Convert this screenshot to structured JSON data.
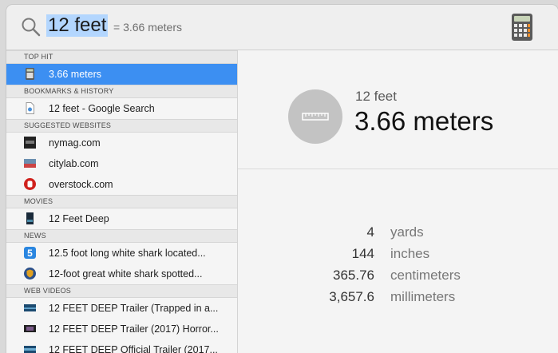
{
  "search": {
    "query": "12 feet",
    "inline_result": "= 3.66 meters"
  },
  "sections": {
    "top_hit": "TOP HIT",
    "bookmarks": "BOOKMARKS & HISTORY",
    "websites": "SUGGESTED WEBSITES",
    "movies": "MOVIES",
    "news": "NEWS",
    "web_videos": "WEB VIDEOS"
  },
  "results": {
    "top_hit": "3.66 meters",
    "bookmark": "12 feet - Google Search",
    "sites": [
      "nymag.com",
      "citylab.com",
      "overstock.com"
    ],
    "movie": "12 Feet Deep",
    "news": [
      "12.5 foot long white shark located...",
      "12-foot great white shark spotted..."
    ],
    "videos": [
      "12 FEET DEEP Trailer (Trapped in a...",
      "12 FEET DEEP Trailer (2017) Horror...",
      "12 FEET DEEP Official Trailer (2017..."
    ]
  },
  "detail": {
    "query": "12 feet",
    "result": "3.66 meters",
    "conversions": [
      {
        "value": "4",
        "unit": "yards"
      },
      {
        "value": "144",
        "unit": "inches"
      },
      {
        "value": "365.76",
        "unit": "centimeters"
      },
      {
        "value": "3,657.6",
        "unit": "millimeters"
      }
    ]
  },
  "colors": {
    "selection": "#3c8ff2",
    "query_highlight": "#b3d6fe"
  },
  "icons": {
    "search": "magnifier-icon",
    "calculator": "calculator-icon",
    "ruler": "ruler-icon"
  }
}
